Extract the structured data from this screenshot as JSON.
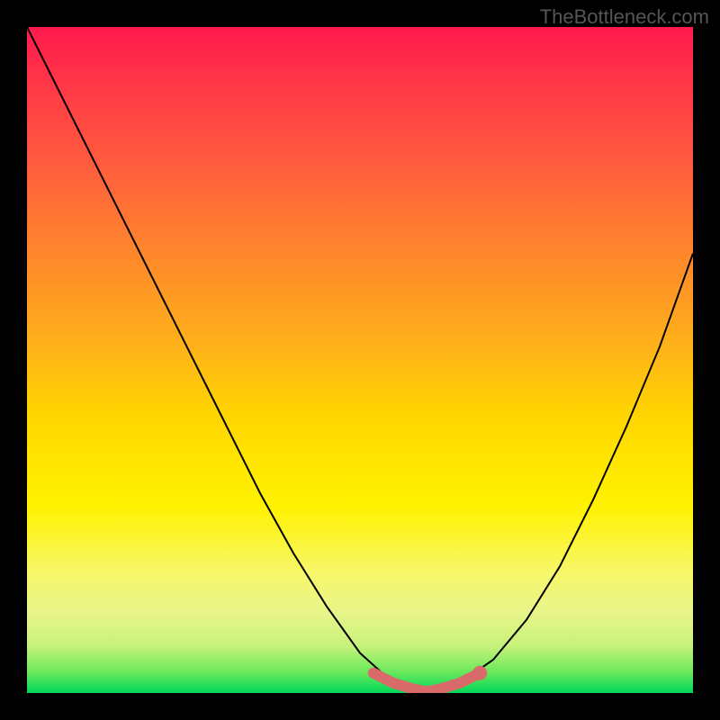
{
  "watermark": "TheBottleneck.com",
  "chart_data": {
    "type": "line",
    "title": "",
    "xlabel": "",
    "ylabel": "",
    "x": [
      0.0,
      0.05,
      0.1,
      0.15,
      0.2,
      0.25,
      0.3,
      0.35,
      0.4,
      0.45,
      0.5,
      0.55,
      0.575,
      0.6,
      0.625,
      0.65,
      0.7,
      0.75,
      0.8,
      0.85,
      0.9,
      0.95,
      1.0
    ],
    "y": [
      1.0,
      0.9,
      0.8,
      0.7,
      0.6,
      0.5,
      0.4,
      0.3,
      0.21,
      0.13,
      0.06,
      0.015,
      0.005,
      0.0,
      0.005,
      0.015,
      0.05,
      0.11,
      0.19,
      0.29,
      0.4,
      0.52,
      0.66
    ],
    "xlim": [
      0,
      1
    ],
    "ylim": [
      0,
      1
    ],
    "highlight": {
      "x": [
        0.52,
        0.55,
        0.58,
        0.6,
        0.62,
        0.65,
        0.68
      ],
      "y": [
        0.03,
        0.015,
        0.006,
        0.002,
        0.006,
        0.015,
        0.03
      ]
    }
  }
}
